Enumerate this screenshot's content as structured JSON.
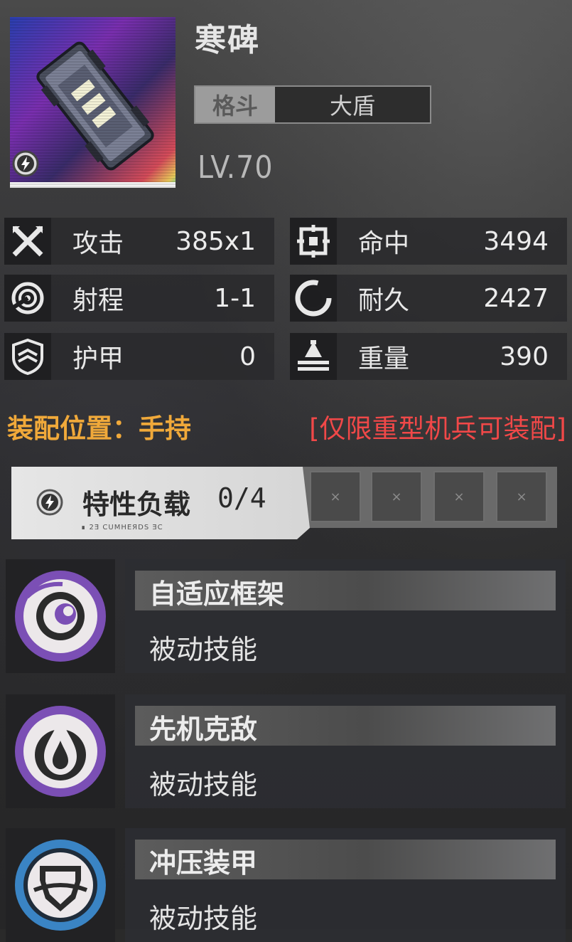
{
  "item": {
    "name": "寒碑",
    "tag_primary": "格斗",
    "tag_secondary": "大盾",
    "level": "LV.70"
  },
  "stats": [
    {
      "icon": "crossed-swords-icon",
      "label": "攻击",
      "value": "385x1"
    },
    {
      "icon": "crosshair-icon",
      "label": "命中",
      "value": "3494"
    },
    {
      "icon": "range-dial-icon",
      "label": "射程",
      "value": "1-1"
    },
    {
      "icon": "durability-ring-icon",
      "label": "耐久",
      "value": "2427"
    },
    {
      "icon": "armor-shield-icon",
      "label": "护甲",
      "value": "0"
    },
    {
      "icon": "weight-icon",
      "label": "重量",
      "value": "390"
    }
  ],
  "mount": {
    "position": "装配位置：手持",
    "restriction": "[仅限重型机兵可装配]"
  },
  "traits": {
    "label": "特性负载",
    "count": "0/4",
    "slot_glyph": "×",
    "micro_text": "∎ 2Ǝ CUMHEЯDS ƎC"
  },
  "skills": [
    {
      "icon": "spiral-eye-icon",
      "name": "自适应框架",
      "type": "被动技能",
      "ring_color": "#7b4fb5"
    },
    {
      "icon": "flame-drop-icon",
      "name": "先机克敌",
      "type": "被动技能",
      "ring_color": "#7b4fb5"
    },
    {
      "icon": "armor-plate-icon",
      "name": "冲压装甲",
      "type": "被动技能",
      "ring_color": "#3a84c4"
    }
  ],
  "colors": {
    "mount_text": "#f0a93a",
    "restriction_text": "#f04848",
    "purple_ring": "#7b4fb5",
    "blue_ring": "#3a84c4"
  }
}
